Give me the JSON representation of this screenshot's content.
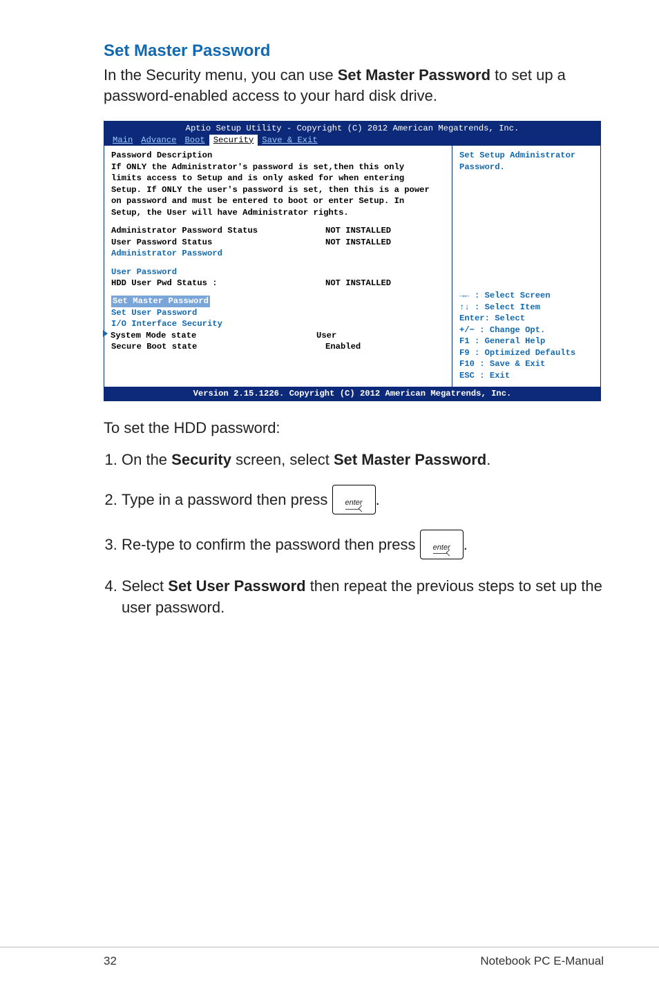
{
  "section_heading": "Set Master Password",
  "intro_before_bold": "In the Security menu, you can use ",
  "intro_bold": "Set Master Password",
  "intro_after_bold": " to set up a password-enabled access to your hard disk drive.",
  "bios": {
    "title": "Aptio Setup Utility - Copyright (C) 2012 American Megatrends, Inc.",
    "tabs": {
      "main": "Main",
      "advance": "Advance",
      "boot": "Boot",
      "security": "Security",
      "save_exit": "Save & Exit"
    },
    "pw_desc_label": "Password Description",
    "pw_desc_body": "If ONLY the Administrator's password is set,then this only limits access to Setup and is only asked for when entering Setup. If ONLY the user's password is set, then this is a power on password and must be entered to boot or enter Setup. In Setup, the User will have Administrator rights.",
    "admin_status_label": "Administrator Password Status",
    "admin_status_value": "NOT INSTALLED",
    "user_status_label": "User Password Status",
    "user_status_value": "NOT INSTALLED",
    "admin_pw_label": "Administrator Password",
    "user_pw_label": "User Password",
    "hdd_status_label": "HDD User Pwd Status :",
    "hdd_status_value": "NOT INSTALLED",
    "set_master": "Set Master Password",
    "set_user": "Set User Password",
    "io_security": "I/O Interface Security",
    "sys_mode_label": "System Mode state",
    "sys_mode_value": "User",
    "secure_boot_label": "Secure Boot state",
    "secure_boot_value": "Enabled",
    "help_title": "Set Setup Administrator Password.",
    "help_lines": {
      "l1": "→←  : Select Screen",
      "l2": "↑↓   : Select Item",
      "l3": "Enter: Select",
      "l4": "+/−  : Change Opt.",
      "l5": "F1   : General Help",
      "l6": "F9   : Optimized Defaults",
      "l7": "F10  : Save & Exit",
      "l8": "ESC  : Exit"
    },
    "footer": "Version 2.15.1226. Copyright (C) 2012 American Megatrends, Inc."
  },
  "after_bios": "To set the HDD password:",
  "steps": {
    "s1_a": "On the ",
    "s1_b1": "Security",
    "s1_c": " screen, select ",
    "s1_b2": "Set Master Password",
    "s1_d": ".",
    "s2": "Type in a password then press ",
    "s2_end": ".",
    "s3": "Re-type to confirm the password then press ",
    "s3_end": ".",
    "s4_a": "Select ",
    "s4_b": "Set User Password",
    "s4_c": " then repeat the previous steps to set up the user password."
  },
  "key_label": "enter",
  "page_number": "32",
  "manual_name": "Notebook PC E-Manual"
}
